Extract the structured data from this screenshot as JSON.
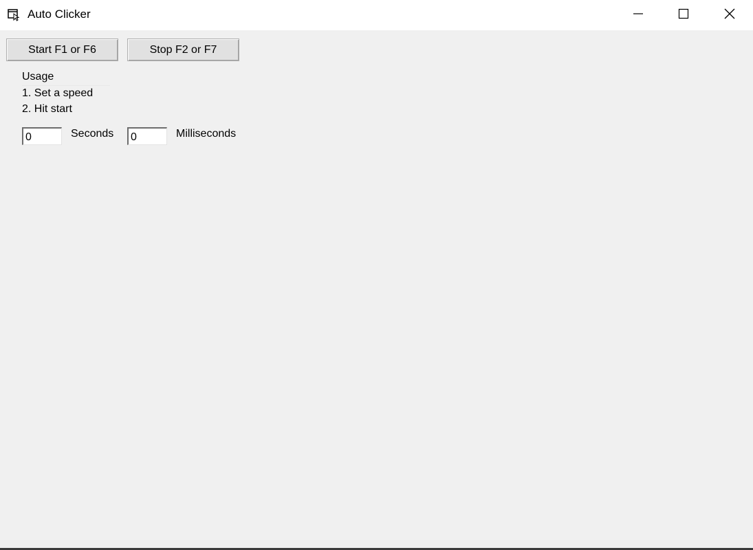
{
  "window": {
    "title": "Auto Clicker",
    "app_icon": "cursor-window-icon",
    "caption_buttons": {
      "minimize_icon": "minimize-icon",
      "maximize_icon": "maximize-icon",
      "close_icon": "close-icon"
    }
  },
  "toolbar": {
    "start_label": "Start F1 or F6",
    "stop_label": "Stop F2 or F7"
  },
  "usage": {
    "title": "Usage",
    "steps": [
      "1. Set a speed",
      "2. Hit start"
    ]
  },
  "speed": {
    "seconds_value": "0",
    "seconds_label": "Seconds",
    "milliseconds_value": "0",
    "milliseconds_label": "Milliseconds"
  },
  "colors": {
    "client_background": "#f0f0f0",
    "titlebar_background": "#ffffff",
    "button_face": "#e1e1e1"
  }
}
